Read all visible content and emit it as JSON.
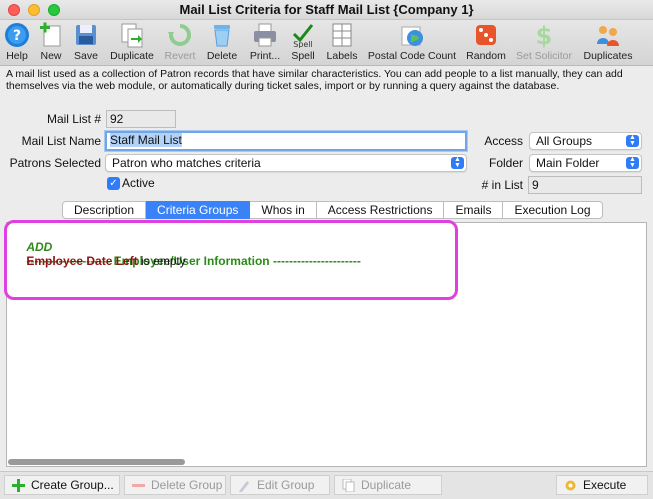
{
  "window": {
    "title": "Mail List Criteria for Staff Mail List {Company 1}"
  },
  "toolbar": {
    "buttons": [
      {
        "label": "Help",
        "icon": "help-icon",
        "enabled": true
      },
      {
        "label": "New",
        "icon": "new-icon",
        "enabled": true
      },
      {
        "label": "Save",
        "icon": "save-icon",
        "enabled": true
      },
      {
        "label": "Duplicate",
        "icon": "duplicate-icon",
        "enabled": true
      },
      {
        "label": "Revert",
        "icon": "revert-icon",
        "enabled": false
      },
      {
        "label": "Delete",
        "icon": "trash-icon",
        "enabled": true
      },
      {
        "label": "Print...",
        "icon": "printer-icon",
        "enabled": true
      },
      {
        "label": "Spell",
        "icon": "spell-check-icon",
        "enabled": true
      },
      {
        "label": "Labels",
        "icon": "labels-icon",
        "enabled": true
      },
      {
        "label": "Postal Code Count",
        "icon": "globe-icon",
        "enabled": true
      },
      {
        "label": "Random",
        "icon": "dice-icon",
        "enabled": true
      },
      {
        "label": "Set Solicitor",
        "icon": "dollar-icon",
        "enabled": false
      },
      {
        "label": "Duplicates",
        "icon": "duplicates-people-icon",
        "enabled": true
      }
    ]
  },
  "description": "A mail list used as a collection of Patron records that have similar characteristics.  You can add people to a list manually, they can add themselves via the web module, or automatically during ticket sales, import or by running a query against the database.",
  "form": {
    "mail_list_num_label": "Mail List #",
    "mail_list_num_value": "92",
    "mail_list_name_label": "Mail List Name",
    "mail_list_name_value": "Staff Mail List",
    "patrons_selected_label": "Patrons Selected",
    "patrons_selected_value": "Patron who matches criteria",
    "active_label": "Active",
    "active_checked": true,
    "access_label": "Access",
    "access_value": "All Groups",
    "folder_label": "Folder",
    "folder_value": "Main Folder",
    "in_list_label": "# in List",
    "in_list_value": "9"
  },
  "tabs": [
    {
      "label": "Description",
      "active": false
    },
    {
      "label": "Criteria Groups",
      "active": true
    },
    {
      "label": "Whos in",
      "active": false
    },
    {
      "label": "Access Restrictions",
      "active": false
    },
    {
      "label": "Emails",
      "active": false
    },
    {
      "label": "Execution Log",
      "active": false
    }
  ],
  "criteria": {
    "add_keyword": "ADD",
    "group_header": "--------------------- Employee/User Information ----------------------",
    "field_name": "Employee Date Left",
    "condition": " is empty"
  },
  "bottombar": {
    "create_group": "Create Group...",
    "delete_group": "Delete Group",
    "edit_group": "Edit Group",
    "duplicate": "Duplicate",
    "execute": "Execute"
  },
  "colors": {
    "accent": "#3a82f7",
    "highlight": "#e040e0",
    "criteria_green": "#2c8a18",
    "criteria_red": "#8b1313"
  }
}
